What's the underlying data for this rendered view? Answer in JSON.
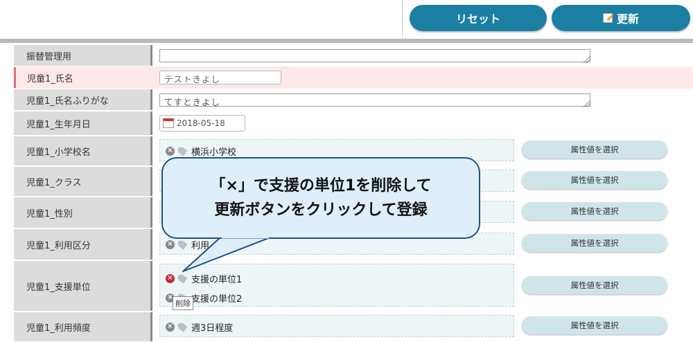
{
  "toolbar": {
    "reset_label": "リセット",
    "update_label": "更新"
  },
  "fields": {
    "furikae": {
      "label": "振替管理用",
      "value": ""
    },
    "name": {
      "label": "児童1_氏名",
      "value": "テストきよし"
    },
    "kana": {
      "label": "児童1_氏名ふりがな",
      "value": "てすときよし"
    },
    "birth": {
      "label": "児童1_生年月日",
      "value": "2018-05-18"
    },
    "school": {
      "label": "児童1_小学校名",
      "items": [
        "横浜小学校"
      ]
    },
    "class": {
      "label": "児童1_クラス"
    },
    "gender": {
      "label": "児童1_性別"
    },
    "usage_type": {
      "label": "児童1_利用区分",
      "items": [
        "利用"
      ]
    },
    "support_unit": {
      "label": "児童1_支援単位",
      "items": [
        "支援の単位1",
        "支援の単位2"
      ],
      "tooltip": "削除"
    },
    "frequency": {
      "label": "児童1_利用頻度",
      "items": [
        "週3日程度"
      ]
    }
  },
  "select_attr_label": "属性値を選択",
  "callout": {
    "line1": "「×」で支援の単位1を削除して",
    "line2": "更新ボタンをクリックして登録"
  },
  "icons": {
    "remove": "remove-icon",
    "tag": "tag-icon",
    "calendar": "calendar-icon",
    "edit": "edit-icon"
  },
  "colors": {
    "primary_button": "#1a7fa3",
    "select_button": "#cfe5ea",
    "highlight_row": "#fde8ea",
    "callout_border": "#1f4e87",
    "remove_active": "#c62833"
  }
}
